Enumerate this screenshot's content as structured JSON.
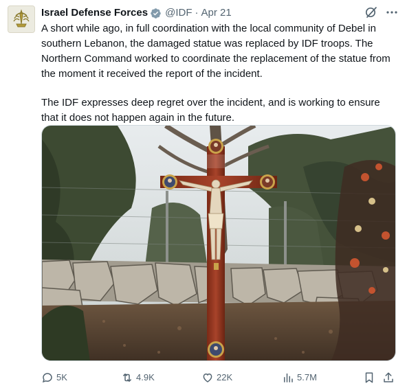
{
  "author": {
    "display_name": "Israel Defense Forces",
    "handle": "@IDF",
    "separator": "·",
    "timestamp": "Apr 21",
    "verified_color": "#829aab",
    "avatar_icon": "idf-emblem-icon"
  },
  "body": {
    "paragraphs": [
      "A short while ago, in full coordination with the local community of Debel in southern Lebanon, the damaged statue was replaced by IDF troops. The Northern Command worked to coordinate the replacement of the statue from the moment it received the report of the incident.",
      "The IDF expresses deep regret over the incident, and is working to ensure that it does not happen again in the future."
    ]
  },
  "header_actions": {
    "grok_icon": "grok-icon",
    "more_icon": "more-icon"
  },
  "media": {
    "kind": "photo",
    "subject": "crucifix statue in a grove"
  },
  "actions": {
    "replies": "5K",
    "reposts": "4.9K",
    "likes": "22K",
    "views": "5.7M"
  },
  "colors": {
    "text": "#0f1419",
    "secondary": "#536471",
    "border": "#cfd9de"
  }
}
